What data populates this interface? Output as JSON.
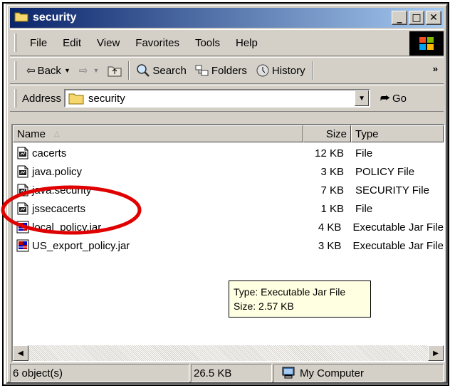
{
  "window": {
    "title": "security"
  },
  "title_buttons": {
    "minimize": "_",
    "maximize": "□",
    "close": "✕"
  },
  "menu": {
    "items": [
      "File",
      "Edit",
      "View",
      "Favorites",
      "Tools",
      "Help"
    ]
  },
  "toolbar": {
    "back_label": "Back",
    "search_label": "Search",
    "folders_label": "Folders",
    "history_label": "History",
    "overflow": "»"
  },
  "address": {
    "label": "Address",
    "value": "security",
    "go_label": "Go"
  },
  "columns": {
    "name": "Name",
    "size": "Size",
    "type": "Type"
  },
  "files": [
    {
      "name": "cacerts",
      "size": "12 KB",
      "type": "File",
      "icon": "generic-file-icon"
    },
    {
      "name": "java.policy",
      "size": "3 KB",
      "type": "POLICY File",
      "icon": "generic-file-icon"
    },
    {
      "name": "java.security",
      "size": "7 KB",
      "type": "SECURITY File",
      "icon": "generic-file-icon"
    },
    {
      "name": "jssecacerts",
      "size": "1 KB",
      "type": "File",
      "icon": "generic-file-icon"
    },
    {
      "name": "local_policy.jar",
      "size": "4 KB",
      "type": "Executable Jar File",
      "icon": "jar-file-icon"
    },
    {
      "name": "US_export_policy.jar",
      "size": "3 KB",
      "type": "Executable Jar File",
      "icon": "jar-file-icon"
    }
  ],
  "tooltip": {
    "type_line": "Type: Executable Jar File",
    "size_line": "Size: 2.57 KB"
  },
  "status": {
    "objects": "6 object(s)",
    "size": "26.5 KB",
    "location": "My Computer"
  },
  "colors": {
    "title_start": "#0a246a",
    "title_end": "#a6caf0",
    "annotation": "#e00000",
    "chrome": "#d4d0c8",
    "tooltip_bg": "#ffffe1"
  }
}
